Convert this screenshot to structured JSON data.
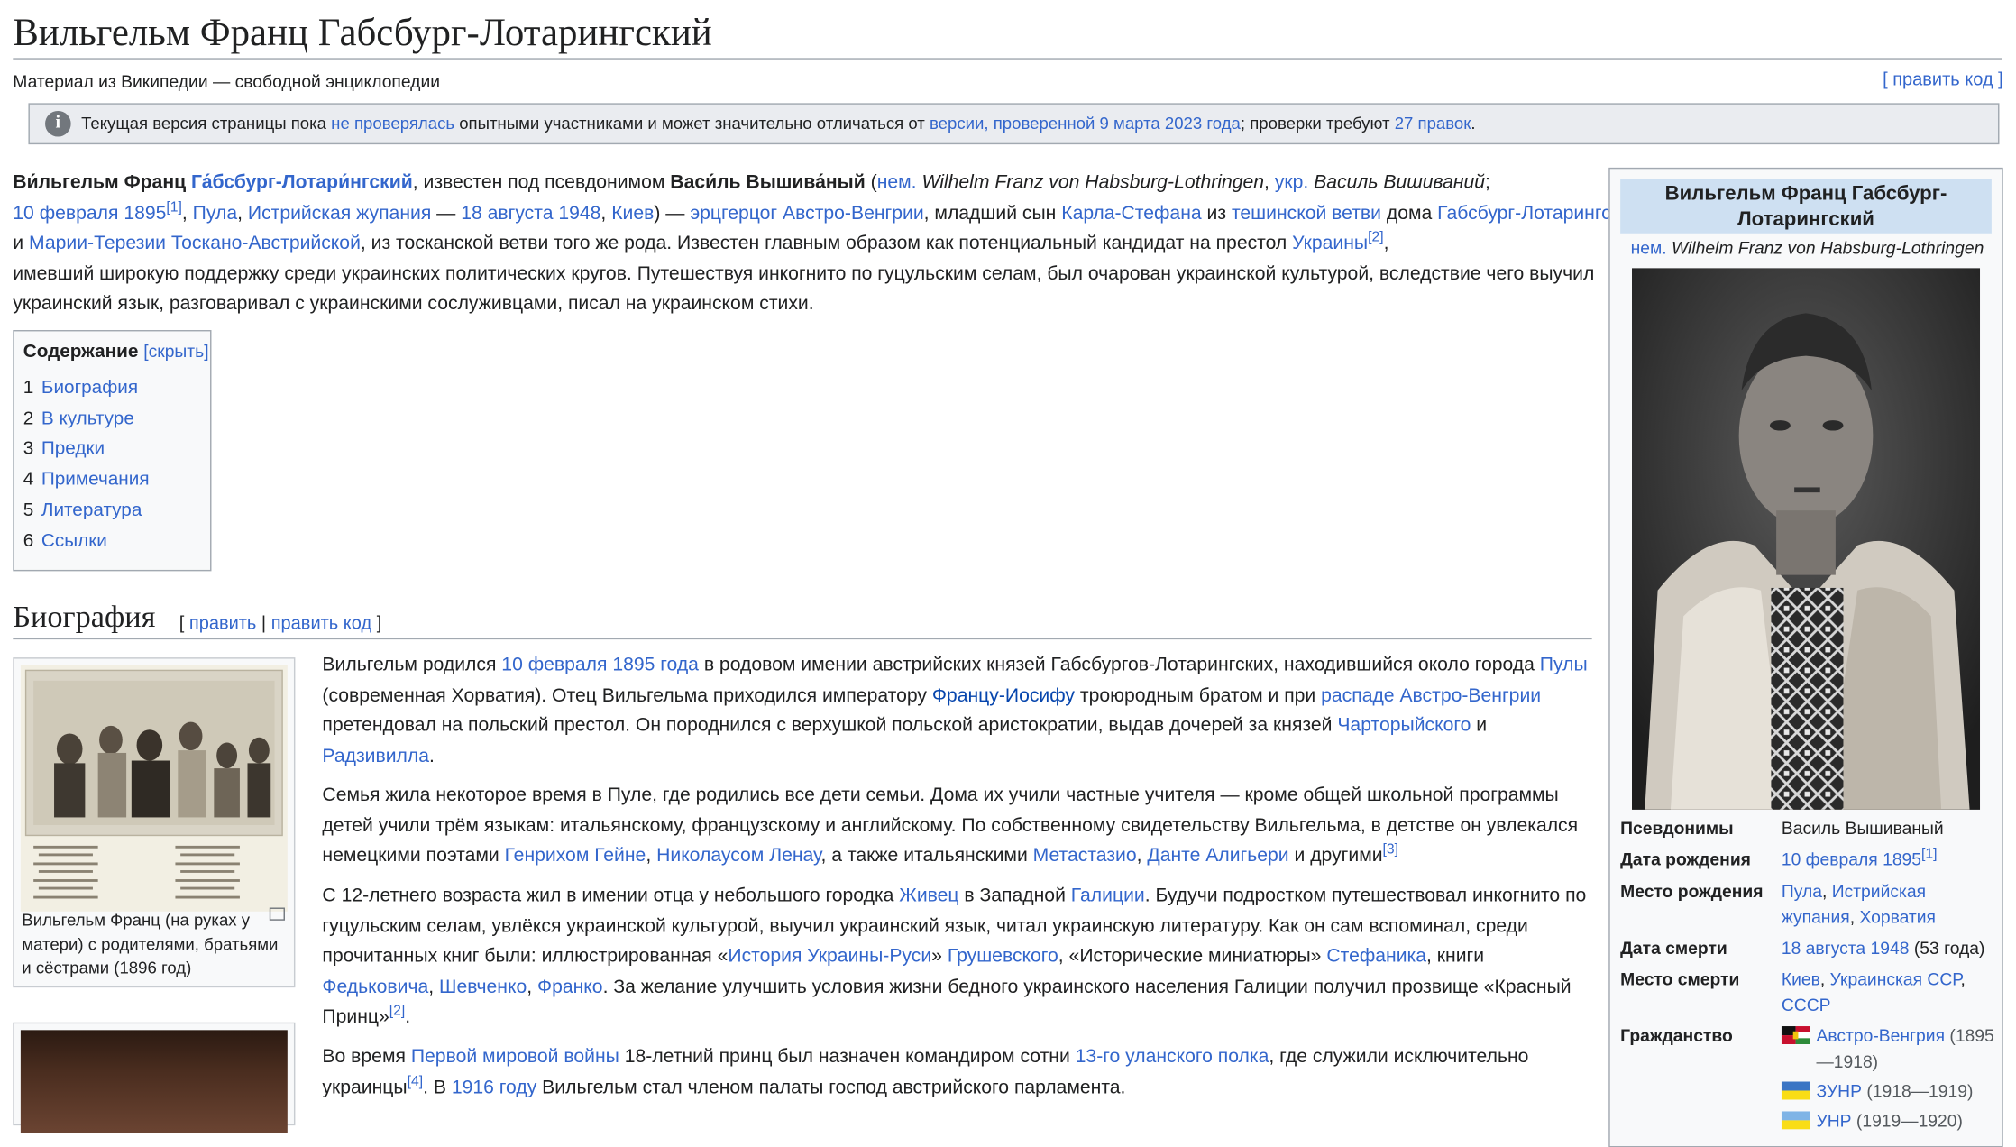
{
  "title": "Вильгельм Франц Габсбург-Лотарингский",
  "tagline": "Материал из Википедии — свободной энциклопедии",
  "edit_code": "[ править код ]",
  "notice": {
    "t1": "Текущая версия страницы пока ",
    "l1": "не проверялась",
    "t2": " опытными участниками и может значительно отличаться от ",
    "l2": "версии, проверенной 9 марта 2023 года",
    "t3": "; проверки требуют ",
    "l3": "27 правок",
    "t4": "."
  },
  "intro": {
    "b1": "Ви́льгельм Франц ",
    "l_habsburg": "Га́бсбург-Лотари́нгский",
    "t1": ", известен под псевдонимом ",
    "b2": "Васи́ль Вышива́ный",
    "t2": " (",
    "l_nem": "нем.",
    "i1": " Wilhelm Franz von Habsburg-Lothringen",
    "t3": ", ",
    "l_ukr": "укр.",
    "i2": " Василь Вишиваний",
    "t4": ";",
    "l_date1": "10 февраля 1895",
    "ref1": "[1]",
    "t5": ", ",
    "l_pula": "Пула",
    "t6": ", ",
    "l_istria": "Истрийская жупания",
    "t7": " — ",
    "l_date2": "18 августа 1948",
    "t8": ", ",
    "l_kiev": "Киев",
    "t9": ") — ",
    "l_archduke": "эрцгерцог Австро-Венгрии",
    "t10": ", младший сын ",
    "l_karl": "Карла-Стефана",
    "t11": " из ",
    "l_teschen": "тешинской ветви",
    "t12": " дома ",
    "l_house": "Габсбург-Лотарингских",
    "t13": " и ",
    "l_maria": "Марии-Терезии Тоскано-Австрийской",
    "t14": ", из тосканской ветви того же рода. Известен главным образом как потенциальный кандидат на престол ",
    "l_ukraine": "Украины",
    "ref2": "[2]",
    "t15": ",",
    "line4": "имевший широкую поддержку среди украинских политических кругов. Путешествуя инкогнито по гуцульским селам, был очарован украинской культурой, вследствие чего выучил",
    "line5": "украинский язык, разговаривал с украинскими сослуживцами, писал на украинском стихи."
  },
  "toc": {
    "title": "Содержание",
    "hide": "[скрыть]",
    "items": [
      {
        "num": "1",
        "label": "Биография"
      },
      {
        "num": "2",
        "label": "В культуре"
      },
      {
        "num": "3",
        "label": "Предки"
      },
      {
        "num": "4",
        "label": "Примечания"
      },
      {
        "num": "5",
        "label": "Литература"
      },
      {
        "num": "6",
        "label": "Ссылки"
      }
    ]
  },
  "section": {
    "title": "Биография",
    "edit_open": "[ ",
    "edit": "править",
    "sep": " | ",
    "edit_code": "править код",
    "edit_close": " ]"
  },
  "thumb1_caption": "Вильгельм Франц (на руках у матери) с родителями, братьями и сёстрами (1896 год)",
  "bio": {
    "p1": {
      "t1": "Вильгельм родился ",
      "l1": "10 февраля 1895 года",
      "t2": " в родовом имении австрийских князей Габсбургов-Лотарингских, находившийся около города ",
      "l2": "Пулы",
      "t3": "(современная Хорватия). Отец Вильгельма приходился императору ",
      "l3": "Францу-Иосифу",
      "t4": " троюродным братом и при ",
      "l4": "распаде Австро-Венгрии",
      "t5": "претендовал на польский престол. Он породнился с верхушкой польской аристократии, выдав дочерей за князей ",
      "l5": "Чарторыйского",
      "t6": " и",
      "l6": "Радзивилла",
      "t7": "."
    },
    "p2": {
      "line1": "Семья жила некоторое время в Пуле, где родились все дети семьи. Дома их учили частные учителя — кроме общей школьной программы",
      "line2": "детей учили трём языкам: итальянскому, французскому и английскому. По собственному свидетельству Вильгельма, в детстве он увлекался",
      "t1": "немецкими поэтами ",
      "l1": "Генрихом Гейне",
      "t2": ", ",
      "l2": "Николаусом Ленау",
      "t3": ", а также итальянскими ",
      "l3": "Метастазио",
      "t4": ", ",
      "l4": "Данте Алигьери",
      "t5": " и другими",
      "ref": "[3]"
    },
    "p3": {
      "t1": "С 12-летнего возраста жил в имении отца у небольшого городка ",
      "l1": "Живец",
      "t2": " в Западной ",
      "l2": "Галиции",
      "t3": ". Будучи подростком путешествовал инкогнито по",
      "line2": "гуцульским селам, увлёкся украинской культурой, выучил украинский язык, читал украинскую литературу. Как он сам вспоминал, среди",
      "t4": "прочитанных книг были: иллюстрированная «",
      "l3": "История Украины-Руси",
      "t5": "» ",
      "l4": "Грушевского",
      "t6": ", «Исторические миниатюры» ",
      "l5": "Стефаника",
      "t7": ", книги",
      "l6": "Федьковича",
      "t8": ", ",
      "l7": "Шевченко",
      "t9": ", ",
      "l8": "Франко",
      "t10": ". За желание улучшить условия жизни бедного украинского населения Галиции получил прозвище «Красный",
      "t11": "Принц»",
      "ref": "[2]",
      "t12": "."
    },
    "p4": {
      "t1": "Во время ",
      "l1": "Первой мировой войны",
      "t2": " 18-летний принц был назначен командиром сотни ",
      "l2": "13-го уланского полка",
      "t3": ", где служили исключительно",
      "t4": "украинцы",
      "ref": "[4]",
      "t5": ". В ",
      "l3": "1916 году",
      "t6": " Вильгельм стал членом палаты господ австрийского парламента."
    }
  },
  "infobox": {
    "title": "Вильгельм Франц Габсбург-Лотарингский",
    "orig_lang": "нем.",
    "orig_name": " Wilhelm Franz von Habsburg-Lothringen",
    "rows": {
      "pseud_label": "Псевдонимы",
      "pseud_value": "Василь Вышиваный",
      "birth_label": "Дата рождения",
      "birth_value": "10 февраля 1895",
      "birth_ref": "[1]",
      "bplace_label": "Место рождения",
      "bplace_v1": "Пула",
      "bplace_v2": "Истрийская жупания",
      "bplace_v3": "Хорватия",
      "death_label": "Дата смерти",
      "death_value": "18 августа 1948",
      "death_age": " (53 года)",
      "dplace_label": "Место смерти",
      "dplace_v1": "Киев",
      "dplace_v2": "Украинская ССР",
      "dplace_v3": "СССР",
      "cit_label": "Гражданство",
      "cit1": "Австро-Венгрия",
      "cit1_years": " (1895",
      "cit1_years2": "—1918)",
      "cit2": "ЗУНР",
      "cit2_years": " (1918—1919)",
      "cit3": "УНР",
      "cit3_years": " (1919—1920)"
    }
  },
  "colors": {
    "link": "#3366cc",
    "infobox_header": "#cee0f2",
    "border": "#a2a9b1"
  }
}
